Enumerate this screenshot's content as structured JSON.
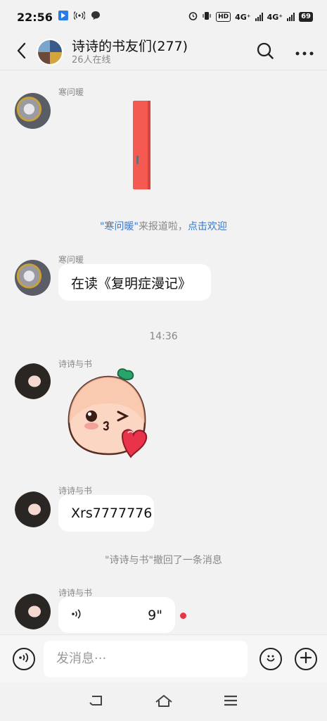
{
  "status": {
    "time": "22:56",
    "hd_label": "HD",
    "net1": "4G⁺",
    "net2": "4G⁺",
    "battery": "69"
  },
  "header": {
    "title": "诗诗的书友们(277)",
    "subtitle": "26人在线"
  },
  "messages": {
    "m1_sender": "寒问暖",
    "sys1_name": "\"寒问暖\"",
    "sys1_mid": "来报道啦，",
    "sys1_link": "点击欢迎",
    "m2_sender": "寒问暖",
    "m2_text": "在读《复明症漫记》",
    "time_divider": "14:36",
    "m3_sender": "诗诗与书",
    "m4_sender": "诗诗与书",
    "m4_text": "Xrs7777776",
    "sys2": "\"诗诗与书\"撤回了一条消息",
    "m5_sender": "诗诗与书",
    "m5_duration": "9\""
  },
  "input": {
    "placeholder": "发消息···"
  },
  "icons": {
    "back": "chevron-left-icon",
    "search": "search-icon",
    "more": "more-dots-icon",
    "voice": "voice-icon",
    "emoji": "emoji-icon",
    "add": "plus-icon"
  },
  "colors": {
    "link": "#3b78c6",
    "unread": "#e8334a",
    "sticker_heart": "#e8334a"
  }
}
